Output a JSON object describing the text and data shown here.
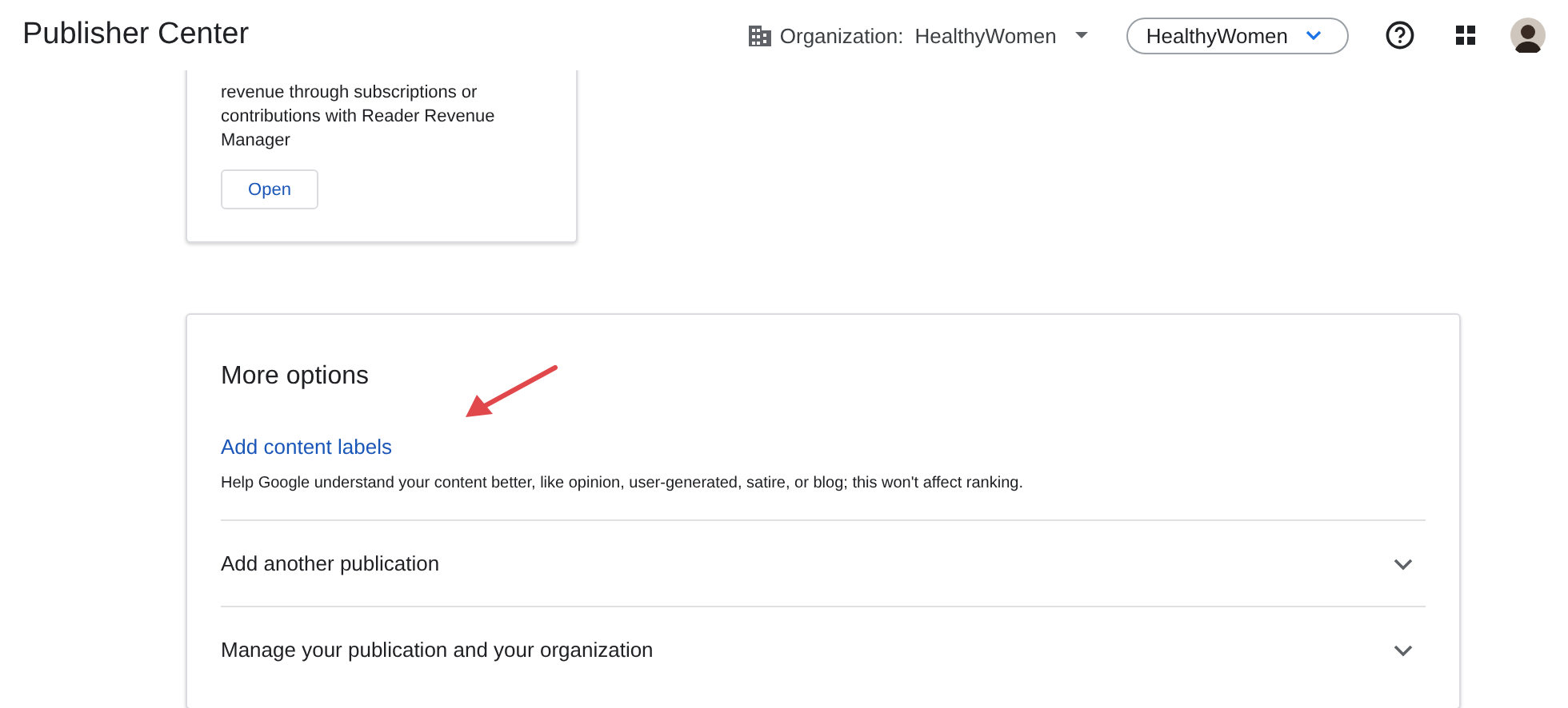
{
  "header": {
    "title": "Publisher Center",
    "organization_label": "Organization:",
    "organization_value": "HealthyWomen",
    "publication_button": "HealthyWomen"
  },
  "top_card": {
    "description_lines": [
      "revenue through subscriptions or",
      "contributions with Reader Revenue Manager"
    ],
    "button": "Open"
  },
  "more_options": {
    "title": "More options",
    "link": "Add content labels",
    "link_description": "Help Google understand your content better, like opinion, user-generated, satire, or blog; this won't affect ranking.",
    "sections": [
      {
        "label": "Add another publication",
        "expanded": false
      },
      {
        "label": "Manage your publication and your organization",
        "expanded": false
      }
    ]
  }
}
